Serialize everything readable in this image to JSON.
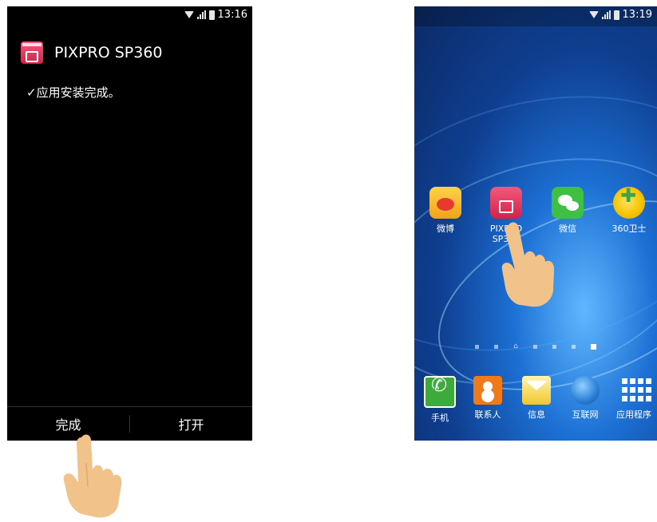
{
  "left_screen": {
    "status": {
      "time": "13:16"
    },
    "app_title": "PIXPRO SP360",
    "install_message": "✓应用安装完成。",
    "buttons": {
      "done": "完成",
      "open": "打开"
    }
  },
  "right_screen": {
    "status": {
      "time": "13:19"
    },
    "home_apps": [
      {
        "label": "微博",
        "icon": "weibo-icon"
      },
      {
        "label_line1": "PIXPRO",
        "label_line2": "SP360",
        "icon": "pixpro-icon"
      },
      {
        "label": "微信",
        "icon": "wechat-icon"
      },
      {
        "label": "360卫士",
        "icon": "security-360-icon"
      }
    ],
    "dock": [
      {
        "label": "手机",
        "icon": "phone-icon"
      },
      {
        "label": "联系人",
        "icon": "contacts-icon"
      },
      {
        "label": "信息",
        "icon": "messages-icon"
      },
      {
        "label": "互联网",
        "icon": "globe-icon"
      },
      {
        "label": "应用程序",
        "icon": "apps-grid-icon"
      }
    ],
    "page_indicator": {
      "pages": 7,
      "active_index": 6,
      "home_index": 2
    }
  },
  "colors": {
    "pixpro_red": "#d6214a",
    "hand_skin": "#f1c38b",
    "wallpaper_blue": "#1c6fd3"
  }
}
